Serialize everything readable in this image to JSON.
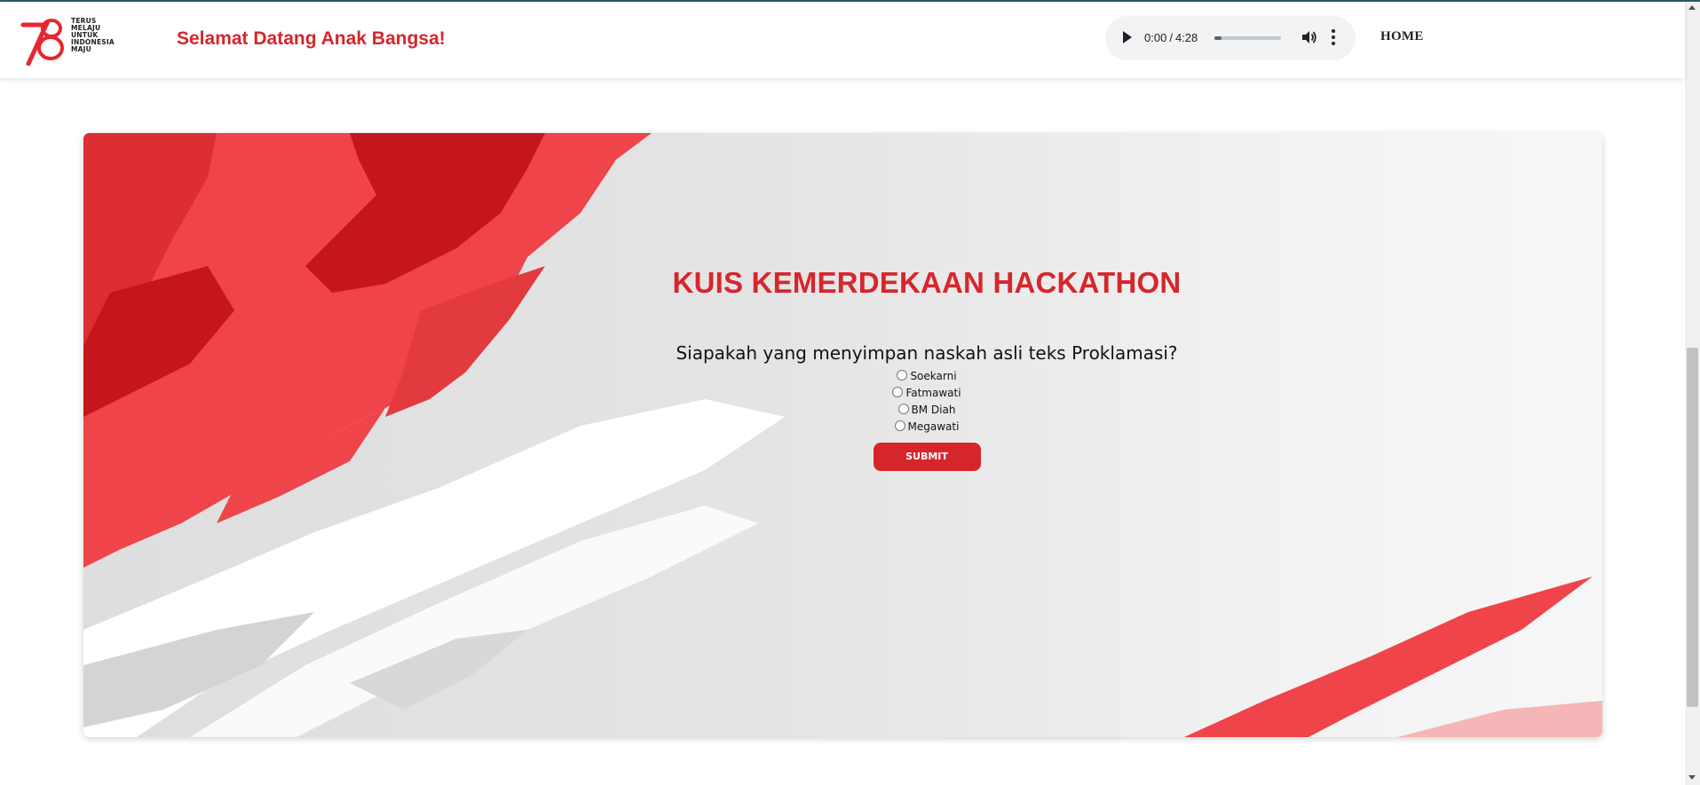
{
  "header": {
    "logo": {
      "icon": "logo-78-icon",
      "lines": [
        "TERUS",
        "MELAJU",
        "UNTUK",
        "INDONESIA",
        "MAJU"
      ],
      "brand_color": "#e8262d"
    },
    "welcome": "Selamat Datang Anak Bangsa!",
    "audio_player": {
      "current_time": "0:00",
      "separator": "/",
      "duration": "4:28",
      "progress_fraction": 0.1
    },
    "nav": {
      "home": "HOME"
    }
  },
  "quiz": {
    "title": "KUIS KEMERDEKAAN HACKATHON",
    "question": "Siapakah yang menyimpan naskah asli teks Proklamasi?",
    "options": [
      "Soekarni",
      "Fatmawati",
      "BM Diah",
      "Megawati"
    ],
    "submit_label": "SUBMIT"
  },
  "colors": {
    "accent": "#d6262c",
    "background_red": "#ef4449",
    "dark_red": "#c4161c"
  }
}
